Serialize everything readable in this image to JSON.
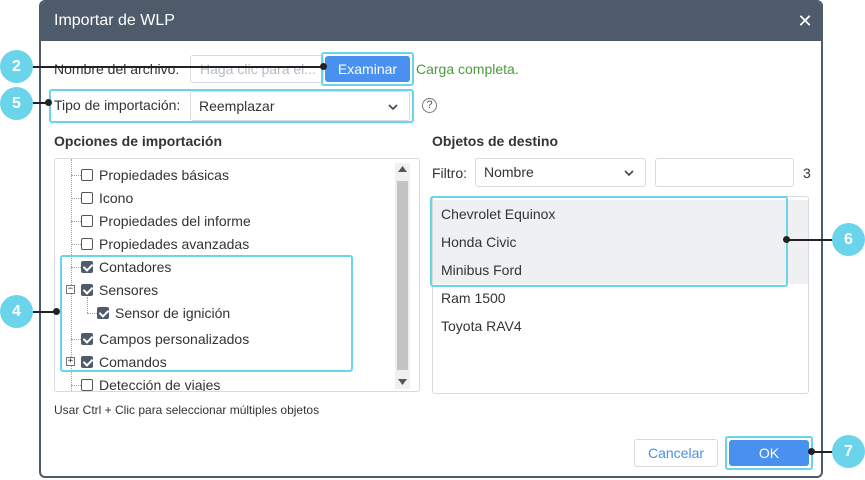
{
  "dialog": {
    "title": "Importar de WLP",
    "close_glyph": "✕",
    "file": {
      "label": "Nombre del archivo:",
      "placeholder": "Haga clic para el...",
      "browse_label": "Examinar",
      "status": "Carga completa."
    },
    "import_type": {
      "label": "Tipo de importación:",
      "selected": "Reemplazar",
      "help_glyph": "?"
    },
    "options": {
      "heading": "Opciones de importación",
      "items": [
        {
          "label": "Propiedades básicas",
          "checked": false
        },
        {
          "label": "Icono",
          "checked": false
        },
        {
          "label": "Propiedades del informe",
          "checked": false
        },
        {
          "label": "Propiedades avanzadas",
          "checked": false
        },
        {
          "label": "Contadores",
          "checked": true
        },
        {
          "label": "Sensores",
          "checked": true,
          "expander": "−"
        },
        {
          "label": "Sensor de ignición",
          "checked": true
        },
        {
          "label": "Campos personalizados",
          "checked": true
        },
        {
          "label": "Comandos",
          "checked": true,
          "expander": "+"
        },
        {
          "label": "Detección de viajes",
          "checked": false
        }
      ],
      "hint": "Usar Ctrl + Clic para seleccionar múltiples objetos"
    },
    "targets": {
      "heading": "Objetos de destino",
      "filter_label": "Filtro:",
      "filter_selected": "Nombre",
      "filter_value": "",
      "count": "3",
      "items": [
        "Chevrolet Equinox",
        "Honda Civic",
        "Minibus Ford",
        "Ram 1500",
        "Toyota RAV4"
      ]
    },
    "buttons": {
      "cancel": "Cancelar",
      "ok": "OK"
    }
  },
  "callouts": [
    "2",
    "5",
    "4",
    "6",
    "7"
  ],
  "colors": {
    "titlebar": "#4e5b6b",
    "primary": "#4a90f0",
    "highlight": "#6ad5ea",
    "success": "#4a9a3a"
  }
}
